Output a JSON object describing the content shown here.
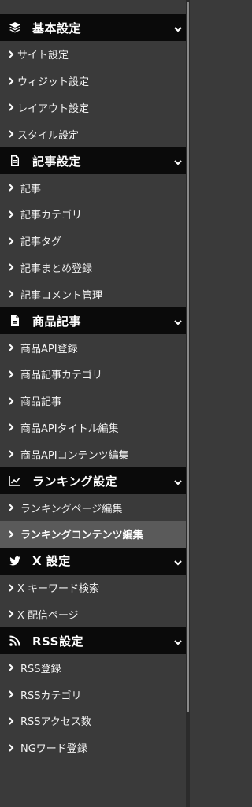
{
  "menu": {
    "sections": [
      {
        "title": "基本設定",
        "icon": "layers-icon",
        "items": [
          {
            "label": "サイト設定"
          },
          {
            "label": "ウィジット設定"
          },
          {
            "label": "レイアウト設定"
          },
          {
            "label": "スタイル設定"
          }
        ]
      },
      {
        "title": "記事設定",
        "icon": "document-icon",
        "items": [
          {
            "label": "記事"
          },
          {
            "label": "記事カテゴリ"
          },
          {
            "label": "記事タグ"
          },
          {
            "label": "記事まとめ登録"
          },
          {
            "label": "記事コメント管理"
          }
        ]
      },
      {
        "title": "商品記事",
        "icon": "file-icon",
        "items": [
          {
            "label": "商品API登録"
          },
          {
            "label": "商品記事カテゴリ"
          },
          {
            "label": "商品記事"
          },
          {
            "label": "商品APIタイトル編集"
          },
          {
            "label": "商品APIコンテンツ編集"
          }
        ]
      },
      {
        "title": "ランキング設定",
        "icon": "line-chart-icon",
        "items": [
          {
            "label": "ランキングページ編集"
          },
          {
            "label": "ランキングコンテンツ編集"
          }
        ]
      },
      {
        "title": "X 設定",
        "icon": "twitter-bird-icon",
        "items": [
          {
            "label": "X キーワード検索"
          },
          {
            "label": "X 配信ページ"
          }
        ]
      },
      {
        "title": "RSS設定",
        "icon": "rss-icon",
        "items": [
          {
            "label": "RSS登録"
          },
          {
            "label": "RSSカテゴリ"
          },
          {
            "label": "RSSアクセス数"
          },
          {
            "label": "NGワード登録"
          }
        ]
      }
    ]
  },
  "active_item": "ランキングコンテンツ編集",
  "colors": {
    "header_bg": "#0a0a0a",
    "item_bg": "#3a3a3a",
    "active_bg": "#5a5a5a"
  }
}
